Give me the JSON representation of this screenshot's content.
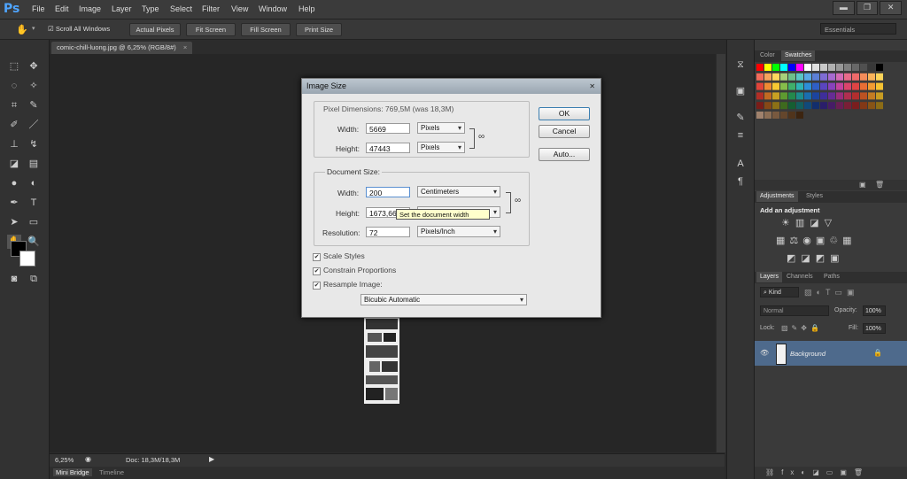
{
  "app": {
    "logo": "Ps"
  },
  "menu": [
    "File",
    "Edit",
    "Image",
    "Layer",
    "Type",
    "Select",
    "Filter",
    "View",
    "Window",
    "Help"
  ],
  "window_controls": {
    "minimize": "▬",
    "restore": "❐",
    "close": "✕"
  },
  "options_bar": {
    "scroll_all": "Scroll All Windows",
    "buttons": [
      "Actual Pixels",
      "Fit Screen",
      "Fill Screen",
      "Print Size"
    ],
    "workspace": "Essentials"
  },
  "document": {
    "tab": "comic-chill-luong.jpg @ 6,25% (RGB/8#)",
    "close": "×"
  },
  "status": {
    "zoom": "6,25%",
    "doc": "Doc: 18,3M/18,3M"
  },
  "bottom_tabs": [
    "Mini Bridge",
    "Timeline"
  ],
  "panels": {
    "color_tabs": [
      "Color",
      "Swatches"
    ],
    "adjust_tabs": [
      "Adjustments",
      "Styles"
    ],
    "adjust_title": "Add an adjustment",
    "layer_tabs": [
      "Layers",
      "Channels",
      "Paths"
    ],
    "kind": "Kind",
    "blend": "Normal",
    "opacity_label": "Opacity:",
    "opacity": "100%",
    "lock_label": "Lock:",
    "fill_label": "Fill:",
    "fill": "100%",
    "layer_name": "Background"
  },
  "dialog": {
    "title": "Image Size",
    "pixel_dims": "Pixel Dimensions:  769,5M (was 18,3M)",
    "px_width_label": "Width:",
    "px_width": "5669",
    "px_width_unit": "Pixels",
    "px_height_label": "Height:",
    "px_height": "47443",
    "px_height_unit": "Pixels",
    "doc_size_label": "Document Size:",
    "doc_width_label": "Width:",
    "doc_width": "200",
    "doc_width_unit": "Centimeters",
    "doc_height_label": "Height:",
    "doc_height": "1673,66",
    "resolution_label": "Resolution:",
    "resolution": "72",
    "resolution_unit": "Pixels/Inch",
    "scale_styles": "Scale Styles",
    "constrain": "Constrain Proportions",
    "resample": "Resample Image:",
    "resample_method": "Bicubic Automatic",
    "ok": "OK",
    "cancel": "Cancel",
    "auto": "Auto...",
    "tooltip": "Set the document width"
  },
  "colors": {
    "accent_blue": "#4fa5ff",
    "layer_selected": "#4e6a8c",
    "tooltip_bg": "#ffffcc"
  }
}
